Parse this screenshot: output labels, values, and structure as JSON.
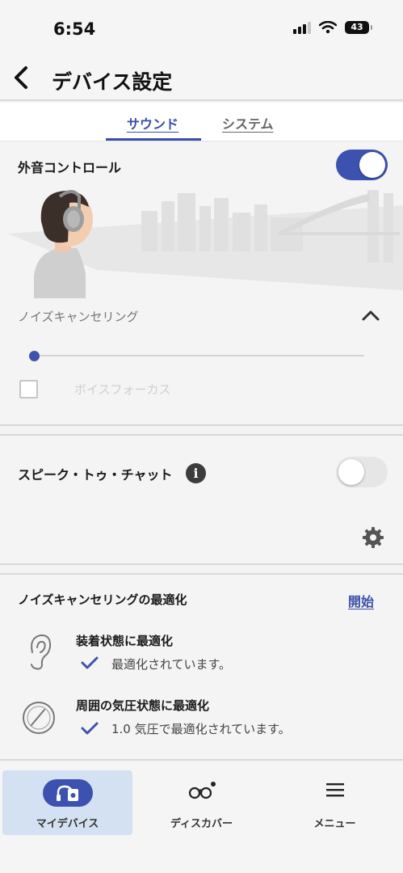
{
  "status_bar": {
    "time": "6:54",
    "battery": "43"
  },
  "header": {
    "title": "デバイス設定"
  },
  "tabs": [
    {
      "label": "サウンド",
      "selected": true
    },
    {
      "label": "システム",
      "selected": false
    }
  ],
  "ambient": {
    "title": "外音コントロール",
    "toggle_on": true,
    "mode_label": "ノイズキャンセリング",
    "slider_level": 0,
    "voice_focus_label": "ボイスフォーカス",
    "voice_focus_checked": false
  },
  "speak_to_chat": {
    "title": "スピーク・トゥ・チャット",
    "toggle_on": false
  },
  "nc_optimizer": {
    "title": "ノイズキャンセリングの最適化",
    "start_label": "開始",
    "items": [
      {
        "title": "装着状態に最適化",
        "status": "最適化されています。",
        "icon": "ear-icon"
      },
      {
        "title": "周囲の気圧状態に最適化",
        "status": "1.0 気圧で最適化されています。",
        "icon": "pressure-gauge-icon"
      }
    ]
  },
  "bottom_nav": [
    {
      "label": "マイデバイス",
      "icon": "headphones-device-icon",
      "active": true
    },
    {
      "label": "ディスカバー",
      "icon": "binoculars-icon",
      "active": false
    },
    {
      "label": "メニュー",
      "icon": "menu-icon",
      "active": false
    }
  ],
  "colors": {
    "accent": "#3d52b0",
    "tab_active": "#3a4ea8",
    "nav_active_bg": "#d3e1f3"
  }
}
